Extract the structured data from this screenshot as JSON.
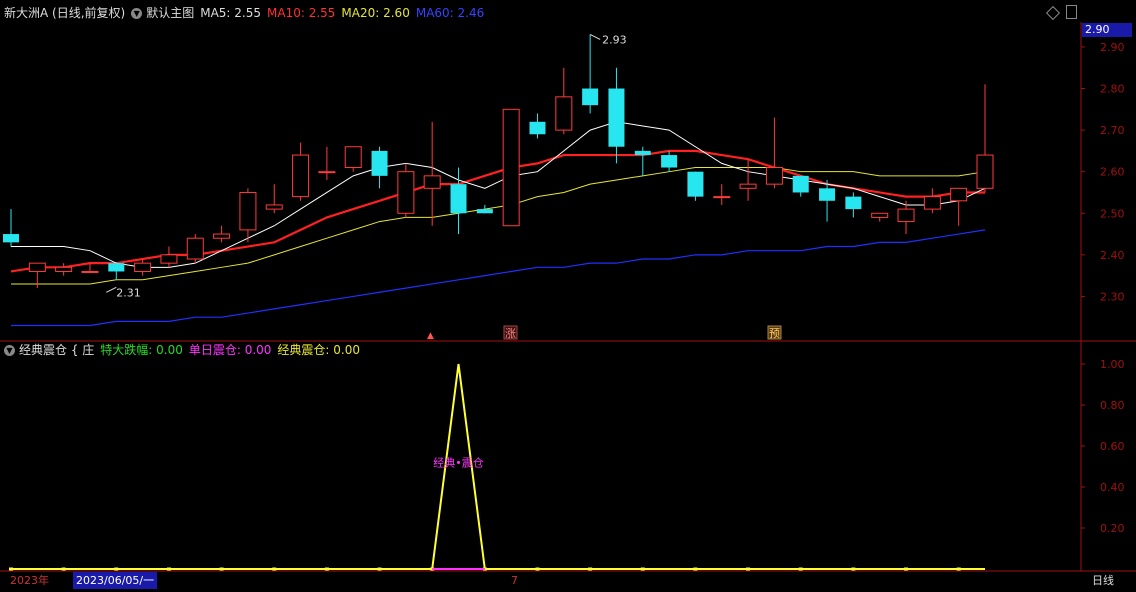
{
  "header": {
    "stock": "新大洲A (日线,前复权)",
    "chart_mode": "默认主图",
    "ma5": "MA5: 2.55",
    "ma10": "MA10: 2.55",
    "ma20": "MA20: 2.60",
    "ma60": "MA60: 2.46"
  },
  "indicator_header": {
    "name": "经典震仓 { 庄",
    "f1": "特大跌幅: 0.00",
    "f2": "单日震仓: 0.00",
    "f3": "经典震仓: 0.00"
  },
  "price_box": "2.90",
  "bottom": {
    "year": "2023年",
    "date": "2023/06/05/一",
    "month_mark": "7",
    "period": "日线"
  },
  "markers": {
    "zhang": "涨",
    "yu": "预",
    "triangle": "▲"
  },
  "annotations": {
    "high": "2.93",
    "low": "2.31",
    "signal": "经典•震仓"
  },
  "colors": {
    "up": "#ff3b3b",
    "down": "#27e6f0",
    "ma5": "#ffffff",
    "ma10": "#ff2020",
    "ma20": "#e6e632",
    "ma60": "#2030ff",
    "axis": "#a01010",
    "indicator": "#ffff33",
    "signal": "#ff33ff"
  },
  "chart_data": [
    {
      "type": "candlestick",
      "y_axis_ticks": [
        "2.90",
        "2.80",
        "2.70",
        "2.60",
        "2.50",
        "2.40",
        "2.30"
      ],
      "ylim": [
        2.2,
        2.96
      ],
      "candles": [
        {
          "o": 2.45,
          "h": 2.51,
          "l": 2.42,
          "c": 2.43
        },
        {
          "o": 2.36,
          "h": 2.38,
          "l": 2.32,
          "c": 2.38
        },
        {
          "o": 2.36,
          "h": 2.38,
          "l": 2.35,
          "c": 2.37
        },
        {
          "o": 2.36,
          "h": 2.38,
          "l": 2.36,
          "c": 2.36
        },
        {
          "o": 2.38,
          "h": 2.38,
          "l": 2.34,
          "c": 2.36
        },
        {
          "o": 2.36,
          "h": 2.39,
          "l": 2.35,
          "c": 2.38
        },
        {
          "o": 2.38,
          "h": 2.42,
          "l": 2.37,
          "c": 2.4
        },
        {
          "o": 2.39,
          "h": 2.45,
          "l": 2.38,
          "c": 2.44
        },
        {
          "o": 2.44,
          "h": 2.47,
          "l": 2.43,
          "c": 2.45
        },
        {
          "o": 2.46,
          "h": 2.56,
          "l": 2.43,
          "c": 2.55
        },
        {
          "o": 2.51,
          "h": 2.57,
          "l": 2.5,
          "c": 2.52
        },
        {
          "o": 2.54,
          "h": 2.67,
          "l": 2.53,
          "c": 2.64
        },
        {
          "o": 2.6,
          "h": 2.66,
          "l": 2.58,
          "c": 2.6
        },
        {
          "o": 2.61,
          "h": 2.66,
          "l": 2.6,
          "c": 2.66
        },
        {
          "o": 2.65,
          "h": 2.66,
          "l": 2.56,
          "c": 2.59
        },
        {
          "o": 2.5,
          "h": 2.62,
          "l": 2.49,
          "c": 2.6
        },
        {
          "o": 2.56,
          "h": 2.72,
          "l": 2.47,
          "c": 2.59
        },
        {
          "o": 2.57,
          "h": 2.61,
          "l": 2.45,
          "c": 2.5
        },
        {
          "o": 2.51,
          "h": 2.52,
          "l": 2.5,
          "c": 2.5
        },
        {
          "o": 2.47,
          "h": 2.75,
          "l": 2.47,
          "c": 2.75
        },
        {
          "o": 2.72,
          "h": 2.74,
          "l": 2.68,
          "c": 2.69
        },
        {
          "o": 2.7,
          "h": 2.85,
          "l": 2.69,
          "c": 2.78
        },
        {
          "o": 2.8,
          "h": 2.93,
          "l": 2.74,
          "c": 2.76
        },
        {
          "o": 2.8,
          "h": 2.85,
          "l": 2.62,
          "c": 2.66
        },
        {
          "o": 2.65,
          "h": 2.66,
          "l": 2.59,
          "c": 2.64
        },
        {
          "o": 2.64,
          "h": 2.65,
          "l": 2.6,
          "c": 2.61
        },
        {
          "o": 2.6,
          "h": 2.6,
          "l": 2.53,
          "c": 2.54
        },
        {
          "o": 2.54,
          "h": 2.57,
          "l": 2.52,
          "c": 2.54
        },
        {
          "o": 2.56,
          "h": 2.63,
          "l": 2.53,
          "c": 2.57
        },
        {
          "o": 2.57,
          "h": 2.73,
          "l": 2.56,
          "c": 2.61
        },
        {
          "o": 2.59,
          "h": 2.59,
          "l": 2.54,
          "c": 2.55
        },
        {
          "o": 2.56,
          "h": 2.58,
          "l": 2.48,
          "c": 2.53
        },
        {
          "o": 2.54,
          "h": 2.55,
          "l": 2.49,
          "c": 2.51
        },
        {
          "o": 2.49,
          "h": 2.5,
          "l": 2.48,
          "c": 2.5
        },
        {
          "o": 2.48,
          "h": 2.53,
          "l": 2.45,
          "c": 2.51
        },
        {
          "o": 2.51,
          "h": 2.56,
          "l": 2.5,
          "c": 2.54
        },
        {
          "o": 2.53,
          "h": 2.56,
          "l": 2.47,
          "c": 2.56
        },
        {
          "o": 2.56,
          "h": 2.81,
          "l": 2.55,
          "c": 2.64
        }
      ],
      "series": [
        {
          "name": "MA5",
          "values": [
            2.42,
            2.42,
            2.42,
            2.41,
            2.38,
            2.37,
            2.37,
            2.38,
            2.41,
            2.44,
            2.47,
            2.51,
            2.55,
            2.59,
            2.61,
            2.62,
            2.61,
            2.58,
            2.56,
            2.59,
            2.6,
            2.65,
            2.7,
            2.72,
            2.71,
            2.7,
            2.66,
            2.62,
            2.6,
            2.59,
            2.58,
            2.57,
            2.56,
            2.54,
            2.52,
            2.52,
            2.53,
            2.56
          ]
        },
        {
          "name": "MA10",
          "values": [
            2.36,
            2.37,
            2.37,
            2.38,
            2.38,
            2.39,
            2.4,
            2.4,
            2.41,
            2.42,
            2.43,
            2.46,
            2.49,
            2.51,
            2.53,
            2.55,
            2.57,
            2.57,
            2.59,
            2.61,
            2.62,
            2.64,
            2.64,
            2.64,
            2.64,
            2.65,
            2.65,
            2.64,
            2.63,
            2.61,
            2.59,
            2.57,
            2.56,
            2.55,
            2.54,
            2.54,
            2.55,
            2.55
          ]
        },
        {
          "name": "MA20",
          "values": [
            2.33,
            2.33,
            2.33,
            2.33,
            2.34,
            2.34,
            2.35,
            2.36,
            2.37,
            2.38,
            2.4,
            2.42,
            2.44,
            2.46,
            2.48,
            2.49,
            2.49,
            2.5,
            2.51,
            2.52,
            2.54,
            2.55,
            2.57,
            2.58,
            2.59,
            2.6,
            2.61,
            2.61,
            2.61,
            2.61,
            2.6,
            2.6,
            2.6,
            2.59,
            2.59,
            2.59,
            2.59,
            2.6
          ]
        },
        {
          "name": "MA60",
          "values": [
            2.23,
            2.23,
            2.23,
            2.23,
            2.24,
            2.24,
            2.24,
            2.25,
            2.25,
            2.26,
            2.27,
            2.28,
            2.29,
            2.3,
            2.31,
            2.32,
            2.33,
            2.34,
            2.35,
            2.36,
            2.37,
            2.37,
            2.38,
            2.38,
            2.39,
            2.39,
            2.4,
            2.4,
            2.41,
            2.41,
            2.41,
            2.42,
            2.42,
            2.43,
            2.43,
            2.44,
            2.45,
            2.46
          ]
        }
      ]
    },
    {
      "type": "line",
      "y_axis_ticks": [
        "1.00",
        "0.80",
        "0.60",
        "0.40",
        "0.20"
      ],
      "ylim": [
        0,
        1.0
      ],
      "series": [
        {
          "name": "经典震仓",
          "values": [
            0,
            0,
            0,
            0,
            0,
            0,
            0,
            0,
            0,
            0,
            0,
            0,
            0,
            0,
            0,
            0,
            0,
            1,
            0,
            0,
            0,
            0,
            0,
            0,
            0,
            0,
            0,
            0,
            0,
            0,
            0,
            0,
            0,
            0,
            0,
            0,
            0,
            0
          ]
        }
      ]
    }
  ]
}
